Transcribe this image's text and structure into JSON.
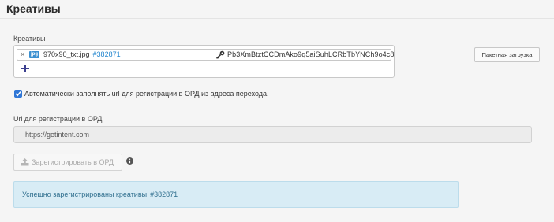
{
  "header": {
    "title": "Креативы"
  },
  "creatives": {
    "label": "Креативы",
    "items": [
      {
        "remove": "×",
        "ext": "jpg",
        "name": "970x90_txt.jpg",
        "id": "#382871",
        "token": "Pb3XmBtztCCDmAko9q5aiSuhLCRbTbYNCh9o4c8"
      }
    ],
    "add_icon": "plus-icon"
  },
  "batch_upload": {
    "label": "Пакетная загрузка"
  },
  "auto_fill": {
    "checked": true,
    "label": "Автоматически заполнять url для регистрации в ОРД из адреса перехода."
  },
  "ord_url": {
    "label": "Url для регистрации в ОРД",
    "value": "https://getintent.com"
  },
  "register_button": {
    "label": "Зарегистрировать в ОРД",
    "icon": "upload-icon",
    "disabled": true
  },
  "info_icon": "info-icon",
  "alert": {
    "text": "Успешно зарегистрированы креативы",
    "id": "#382871"
  },
  "colors": {
    "accent": "#2f76d6",
    "link": "#2a8ad0",
    "alert_bg": "#d8ecf5",
    "alert_text": "#31708f"
  }
}
